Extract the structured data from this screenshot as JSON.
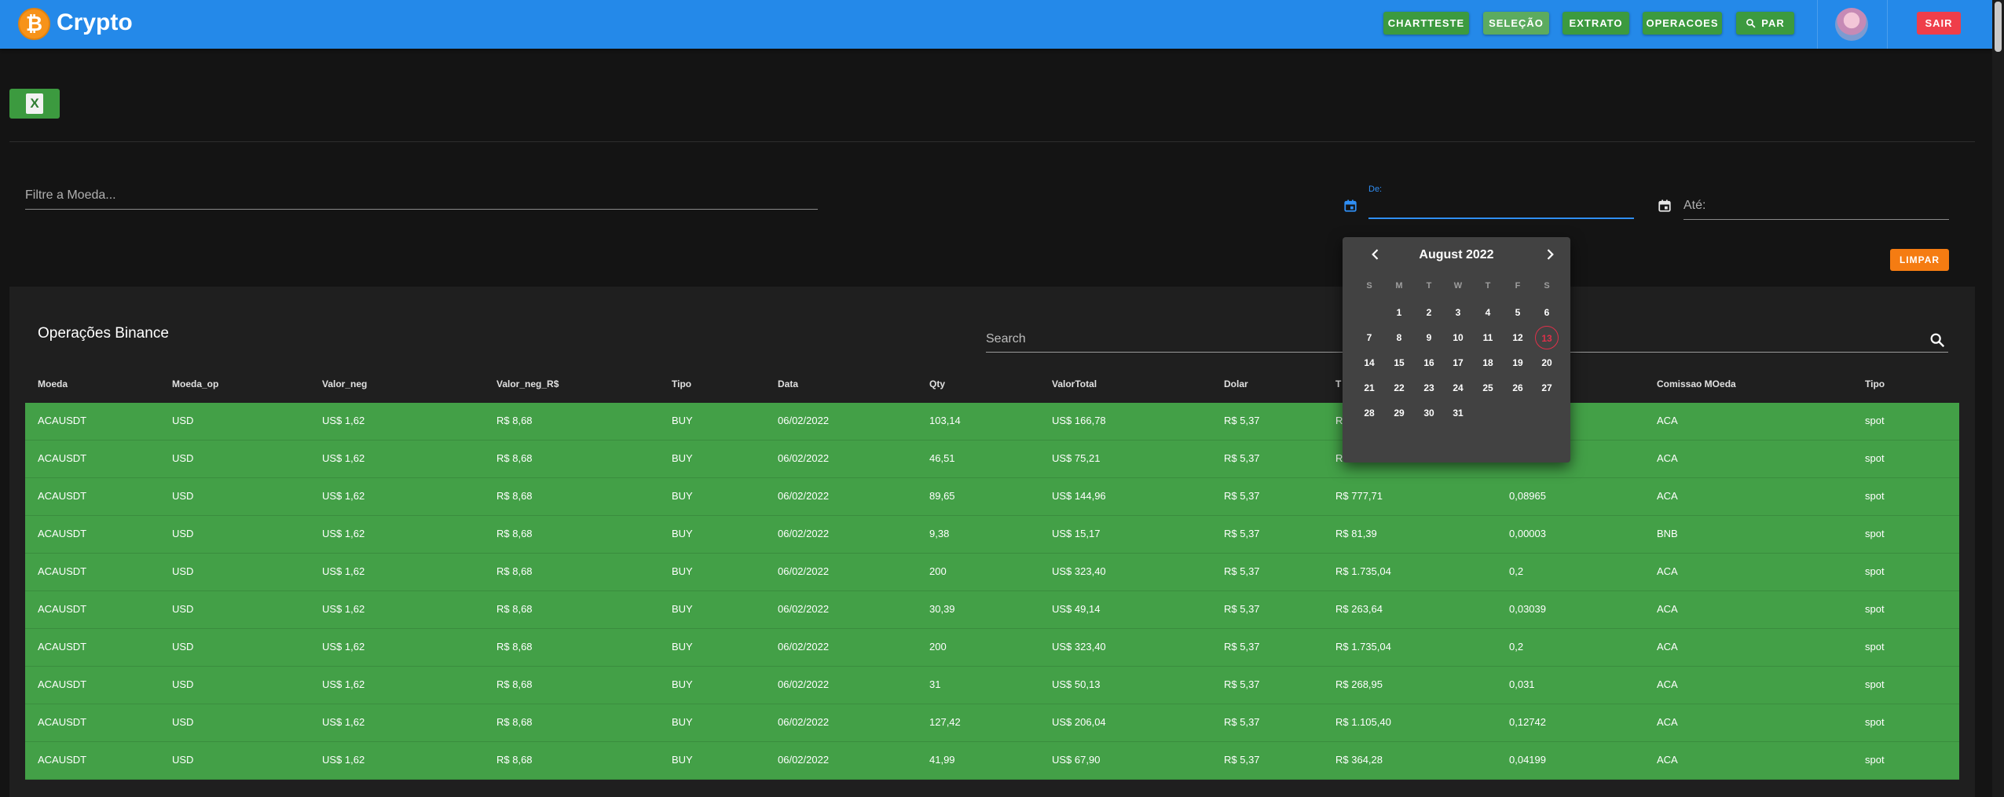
{
  "app": {
    "title": "Crypto",
    "logo_symbol": "₿"
  },
  "nav": [
    {
      "label": "CHARTTESTE",
      "active": false
    },
    {
      "label": "SELEÇÃO",
      "active": true
    },
    {
      "label": "EXTRATO",
      "active": false
    },
    {
      "label": "OPERACOES",
      "active": false
    },
    {
      "label": "PAR",
      "active": false,
      "icon": "search-icon"
    }
  ],
  "logout_label": "SAIR",
  "filter": {
    "placeholder": "Filtre a Moeda..."
  },
  "date_from": {
    "label": "De:"
  },
  "date_to": {
    "label": "Até:"
  },
  "clear_label": "LIMPAR",
  "card": {
    "title": "Operações Binance",
    "search_placeholder": "Search"
  },
  "table": {
    "columns": [
      "Moeda",
      "Moeda_op",
      "Valor_neg",
      "Valor_neg_R$",
      "Tipo",
      "Data",
      "Qty",
      "ValorTotal",
      "Dolar",
      "T",
      "",
      "Comissao MOeda",
      "Tipo"
    ],
    "rows": [
      [
        "ACAUSDT",
        "USD",
        "US$ 1,62",
        "R$ 8,68",
        "BUY",
        "06/02/2022",
        "103,14",
        "US$ 166,78",
        "R$ 5,37",
        "R",
        "",
        "ACA",
        "spot"
      ],
      [
        "ACAUSDT",
        "USD",
        "US$ 1,62",
        "R$ 8,68",
        "BUY",
        "06/02/2022",
        "46,51",
        "US$ 75,21",
        "R$ 5,37",
        "R",
        "",
        "ACA",
        "spot"
      ],
      [
        "ACAUSDT",
        "USD",
        "US$ 1,62",
        "R$ 8,68",
        "BUY",
        "06/02/2022",
        "89,65",
        "US$ 144,96",
        "R$ 5,37",
        "R$ 777,71",
        "0,08965",
        "ACA",
        "spot"
      ],
      [
        "ACAUSDT",
        "USD",
        "US$ 1,62",
        "R$ 8,68",
        "BUY",
        "06/02/2022",
        "9,38",
        "US$ 15,17",
        "R$ 5,37",
        "R$ 81,39",
        "0,00003",
        "BNB",
        "spot"
      ],
      [
        "ACAUSDT",
        "USD",
        "US$ 1,62",
        "R$ 8,68",
        "BUY",
        "06/02/2022",
        "200",
        "US$ 323,40",
        "R$ 5,37",
        "R$ 1.735,04",
        "0,2",
        "ACA",
        "spot"
      ],
      [
        "ACAUSDT",
        "USD",
        "US$ 1,62",
        "R$ 8,68",
        "BUY",
        "06/02/2022",
        "30,39",
        "US$ 49,14",
        "R$ 5,37",
        "R$ 263,64",
        "0,03039",
        "ACA",
        "spot"
      ],
      [
        "ACAUSDT",
        "USD",
        "US$ 1,62",
        "R$ 8,68",
        "BUY",
        "06/02/2022",
        "200",
        "US$ 323,40",
        "R$ 5,37",
        "R$ 1.735,04",
        "0,2",
        "ACA",
        "spot"
      ],
      [
        "ACAUSDT",
        "USD",
        "US$ 1,62",
        "R$ 8,68",
        "BUY",
        "06/02/2022",
        "31",
        "US$ 50,13",
        "R$ 5,37",
        "R$ 268,95",
        "0,031",
        "ACA",
        "spot"
      ],
      [
        "ACAUSDT",
        "USD",
        "US$ 1,62",
        "R$ 8,68",
        "BUY",
        "06/02/2022",
        "127,42",
        "US$ 206,04",
        "R$ 5,37",
        "R$ 1.105,40",
        "0,12742",
        "ACA",
        "spot"
      ],
      [
        "ACAUSDT",
        "USD",
        "US$ 1,62",
        "R$ 8,68",
        "BUY",
        "06/02/2022",
        "41,99",
        "US$ 67,90",
        "R$ 5,37",
        "R$ 364,28",
        "0,04199",
        "ACA",
        "spot"
      ]
    ]
  },
  "datepicker": {
    "month_label": "August 2022",
    "weekdays": [
      "S",
      "M",
      "T",
      "W",
      "T",
      "F",
      "S"
    ],
    "first_weekday": 1,
    "days_in_month": 31,
    "today": 13
  },
  "colors": {
    "appbar": "#2489e9",
    "nav_button": "#3c9a3f",
    "row": "#43a047",
    "logout": "#ef3e4a",
    "clear": "#f57c12",
    "date_focus": "#2f8ef4",
    "today_ring": "#e0304a"
  }
}
